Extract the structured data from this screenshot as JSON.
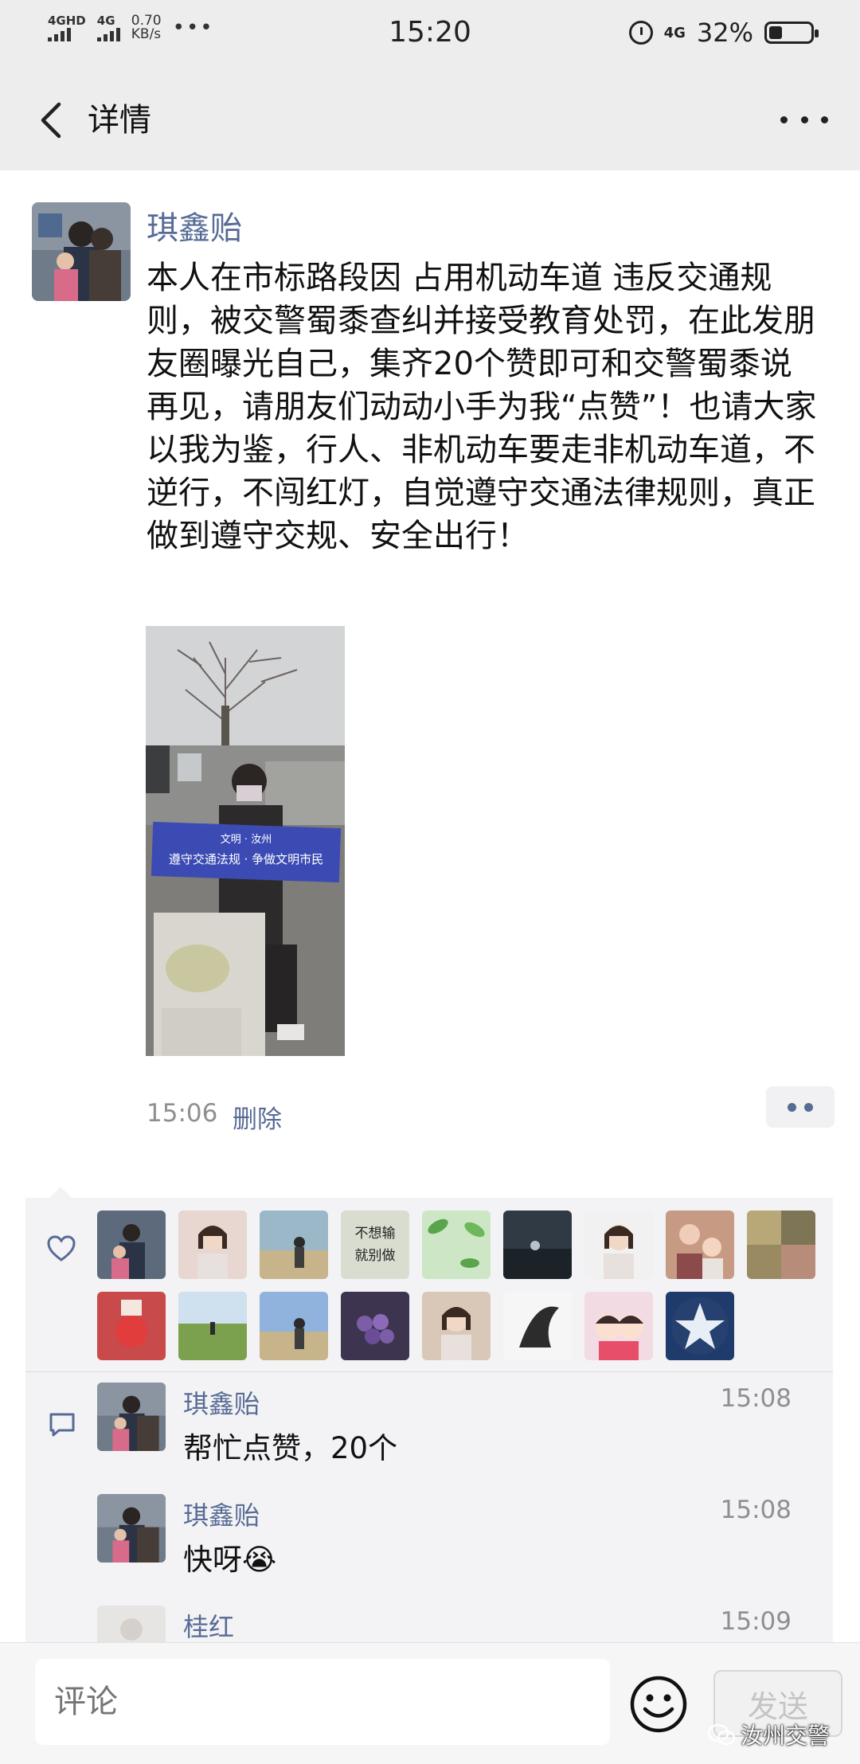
{
  "status_bar": {
    "signal1": "4GHD",
    "signal2": "4G",
    "speed_value": "0.70",
    "speed_unit": "KB/s",
    "more": "•••",
    "time": "15:20",
    "network": "4G",
    "battery_percent": "32%",
    "battery_level": 0.32
  },
  "nav": {
    "title": "详情",
    "back_icon": "chevron-left-icon",
    "more_icon": "more-dots-icon"
  },
  "post": {
    "author": "琪鑫贻",
    "text": "本人在市标路段因 占用机动车道 违反交通规则，被交警蜀黍查纠并接受教育处罚，在此发朋友圈曝光自己，集齐20个赞即可和交警蜀黍说再见，请朋友们动动小手为我“点赞”！也请大家以我为鉴，行人、非机动车要走非机动车道，不逆行，不闯红灯，自觉遵守交通法律规则，真正做到遵守交规、安全出行！",
    "banner_line1": "文明 · 汝州",
    "banner_line2": "遵守交通法规 · 争做文明市民",
    "time": "15:06",
    "delete_label": "删除"
  },
  "likes": {
    "icon": "heart-outline-icon",
    "avatars": [
      {
        "color": "#5c6a7c",
        "kind": "family"
      },
      {
        "color": "#e8d6d0",
        "kind": "girl"
      },
      {
        "color": "#9bb8c9",
        "kind": "beach"
      },
      {
        "color": "#d8ddd0",
        "kind": "calligraphy",
        "text1": "不想输",
        "text2": "就别做"
      },
      {
        "color": "#cde7c6",
        "kind": "leaves"
      },
      {
        "color": "#2f3a44",
        "kind": "dark"
      },
      {
        "color": "#f1f1f1",
        "kind": "woman"
      },
      {
        "color": "#c79a83",
        "kind": "mother"
      },
      {
        "color": "#9a8a62",
        "kind": "collage"
      },
      {
        "color": "#c94a4a",
        "kind": "fruit"
      },
      {
        "color": "#86a860",
        "kind": "field"
      },
      {
        "color": "#8fb3dd",
        "kind": "sky"
      },
      {
        "color": "#3d3550",
        "kind": "grapes"
      },
      {
        "color": "#d9c8b8",
        "kind": "selfie"
      },
      {
        "color": "#f6f6f6",
        "kind": "ink"
      },
      {
        "color": "#f3dbe3",
        "kind": "cartoon"
      },
      {
        "color": "#1f3b6c",
        "kind": "star"
      }
    ]
  },
  "comments": {
    "icon": "comment-bubble-icon",
    "items": [
      {
        "author": "琪鑫贻",
        "time": "15:08",
        "text": "帮忙点赞，20个",
        "avatar": "family"
      },
      {
        "author": "琪鑫贻",
        "time": "15:08",
        "text": "快呀😭",
        "avatar": "family"
      },
      {
        "author": "桂红",
        "time": "15:09",
        "text": "",
        "avatar": "plain"
      }
    ]
  },
  "bottom": {
    "placeholder": "评论",
    "send_label": "发送",
    "emoji_icon": "smiley-icon",
    "watermark": "汝州交警"
  }
}
